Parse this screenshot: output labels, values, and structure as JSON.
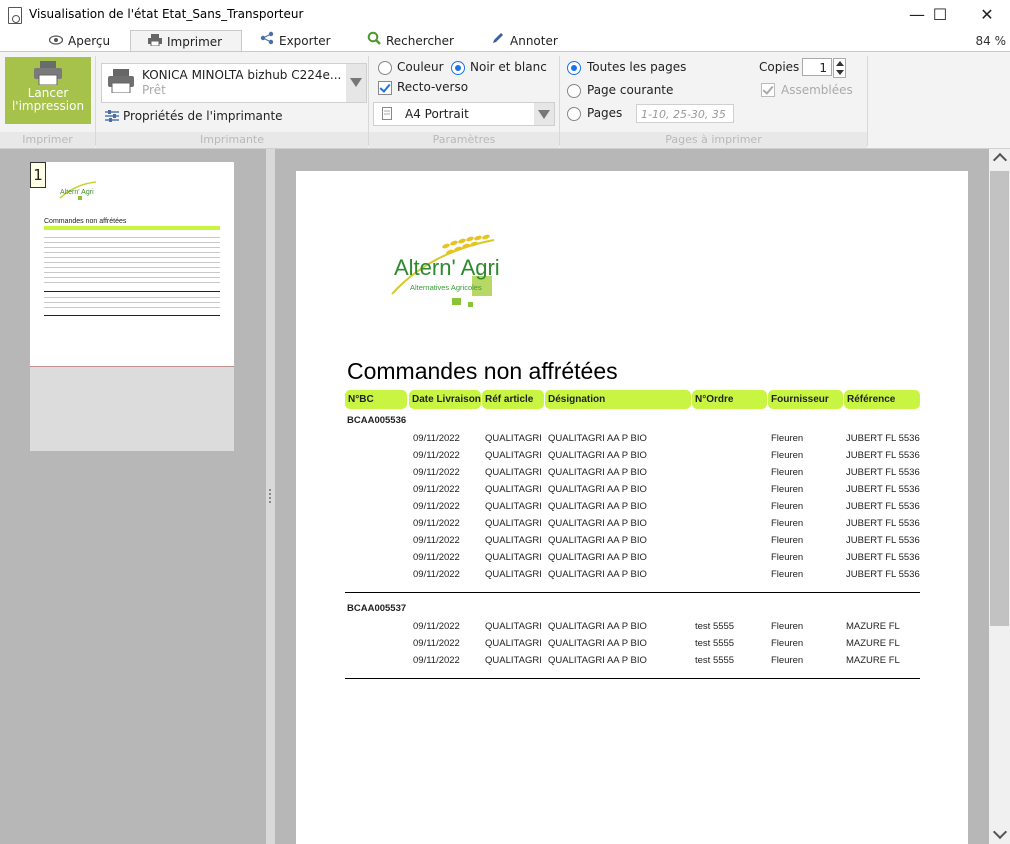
{
  "window": {
    "title": "Visualisation de l'état Etat_Sans_Transporteur",
    "minimize": "—",
    "maximize": "☐",
    "close": "✕"
  },
  "tabs": [
    {
      "label": "Aperçu",
      "icon": "eye-icon"
    },
    {
      "label": "Imprimer",
      "icon": "printer-icon",
      "active": true
    },
    {
      "label": "Exporter",
      "icon": "share-icon"
    },
    {
      "label": "Rechercher",
      "icon": "search-icon"
    },
    {
      "label": "Annoter",
      "icon": "pen-icon"
    }
  ],
  "zoom": "84 %",
  "ribbon": {
    "print_group": {
      "button_label_line1": "Lancer",
      "button_label_line2": "l'impression",
      "group_label": "Imprimer"
    },
    "printer_group": {
      "printer_name": "KONICA MINOLTA bizhub C224e...",
      "printer_status": "Prêt",
      "properties_label": "Propriétés de l'imprimante",
      "group_label": "Imprimante"
    },
    "params_group": {
      "color_label": "Couleur",
      "bw_label": "Noir et blanc",
      "color_mode": "Noir et blanc",
      "duplex_label": "Recto-verso",
      "duplex_checked": true,
      "paper": "A4 Portrait",
      "group_label": "Paramètres"
    },
    "pages_group": {
      "all_pages_label": "Toutes les pages",
      "current_page_label": "Page courante",
      "pages_label": "Pages",
      "selected": "Toutes les pages",
      "pages_placeholder": "1-10, 25-30, 35",
      "copies_label": "Copies",
      "copies_value": "1",
      "collated_label": "Assemblées",
      "collated_checked": true,
      "group_label": "Pages à imprimer"
    }
  },
  "thumbnail": {
    "page_number": "1"
  },
  "report": {
    "logo_text_main": "Altern' Agri",
    "logo_text_sub": "Alternatives Agricoles",
    "title": "Commandes non affrétées",
    "columns": [
      "N°BC",
      "Date Livraison",
      "Réf article",
      "Désignation",
      "N°Ordre",
      "Fournisseur",
      "Référence"
    ],
    "groups": [
      {
        "bc": "BCAA005536",
        "rows": [
          [
            "09/11/2022",
            "QUALITAGRI",
            "QUALITAGRI AA P BIO",
            "",
            "Fleuren",
            "JUBERT FL 5536"
          ],
          [
            "09/11/2022",
            "QUALITAGRI",
            "QUALITAGRI AA P BIO",
            "",
            "Fleuren",
            "JUBERT FL 5536"
          ],
          [
            "09/11/2022",
            "QUALITAGRI",
            "QUALITAGRI AA P BIO",
            "",
            "Fleuren",
            "JUBERT FL 5536"
          ],
          [
            "09/11/2022",
            "QUALITAGRI",
            "QUALITAGRI AA P BIO",
            "",
            "Fleuren",
            "JUBERT FL 5536"
          ],
          [
            "09/11/2022",
            "QUALITAGRI",
            "QUALITAGRI AA P BIO",
            "",
            "Fleuren",
            "JUBERT FL 5536"
          ],
          [
            "09/11/2022",
            "QUALITAGRI",
            "QUALITAGRI AA P BIO",
            "",
            "Fleuren",
            "JUBERT FL 5536"
          ],
          [
            "09/11/2022",
            "QUALITAGRI",
            "QUALITAGRI AA P BIO",
            "",
            "Fleuren",
            "JUBERT FL 5536"
          ],
          [
            "09/11/2022",
            "QUALITAGRI",
            "QUALITAGRI AA P BIO",
            "",
            "Fleuren",
            "JUBERT FL 5536"
          ],
          [
            "09/11/2022",
            "QUALITAGRI",
            "QUALITAGRI AA P BIO",
            "",
            "Fleuren",
            "JUBERT FL 5536"
          ]
        ]
      },
      {
        "bc": "BCAA005537",
        "rows": [
          [
            "09/11/2022",
            "QUALITAGRI",
            "QUALITAGRI AA P BIO",
            "test 5555",
            "Fleuren",
            "MAZURE FL"
          ],
          [
            "09/11/2022",
            "QUALITAGRI",
            "QUALITAGRI AA P BIO",
            "test 5555",
            "Fleuren",
            "MAZURE FL"
          ],
          [
            "09/11/2022",
            "QUALITAGRI",
            "QUALITAGRI AA P BIO",
            "test 5555",
            "Fleuren",
            "MAZURE FL"
          ]
        ]
      }
    ]
  },
  "colors": {
    "accent_green": "#a6c24a",
    "header_green": "#c8f542",
    "radio_blue": "#1a73e8"
  }
}
